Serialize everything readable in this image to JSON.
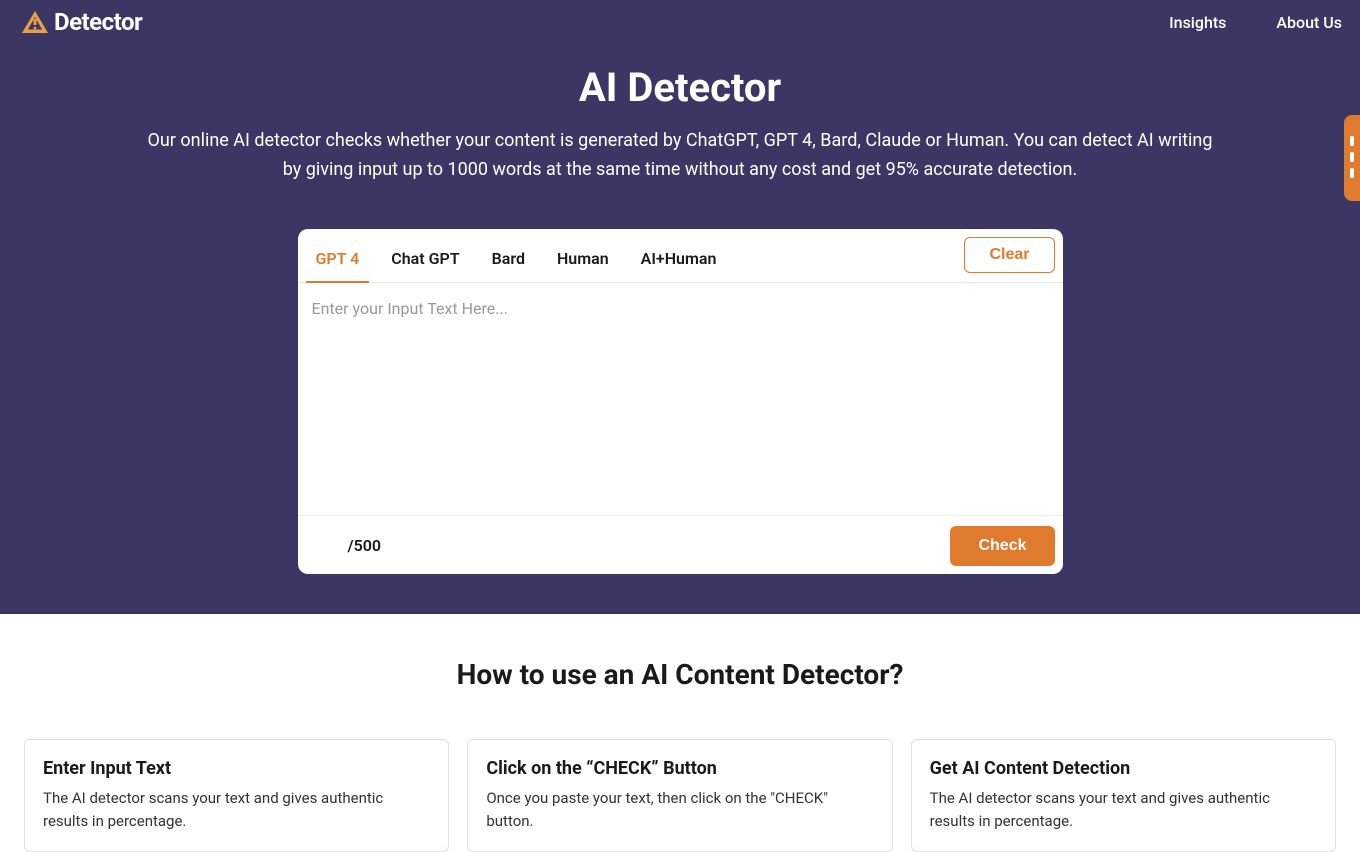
{
  "nav": {
    "logo_text": "Detector",
    "links": {
      "insights": "Insights",
      "about": "About Us"
    }
  },
  "hero": {
    "title": "AI Detector",
    "subtitle": "Our online AI detector checks whether your content is generated by ChatGPT, GPT 4, Bard, Claude or Human. You can detect AI writing by giving input up to 1000 words at the same time without any cost and get 95% accurate detection."
  },
  "card": {
    "tabs": {
      "gpt4": "GPT 4",
      "chatgpt": "Chat GPT",
      "bard": "Bard",
      "human": "Human",
      "aihuman": "AI+Human"
    },
    "clear_label": "Clear",
    "textarea_placeholder": "Enter your Input Text Here...",
    "counter": "/500",
    "check_label": "Check"
  },
  "howto": {
    "title": "How to use an AI Content Detector?",
    "steps": [
      {
        "title": "Enter Input Text",
        "body": "The AI detector scans your text and gives authentic results in percentage."
      },
      {
        "title": "Click on the “CHECK” Button",
        "body": "Once you paste your text, then click on the \"CHECK\" button."
      },
      {
        "title": "Get AI Content Detection",
        "body": "The AI detector scans your text and gives authentic results in percentage."
      }
    ]
  }
}
